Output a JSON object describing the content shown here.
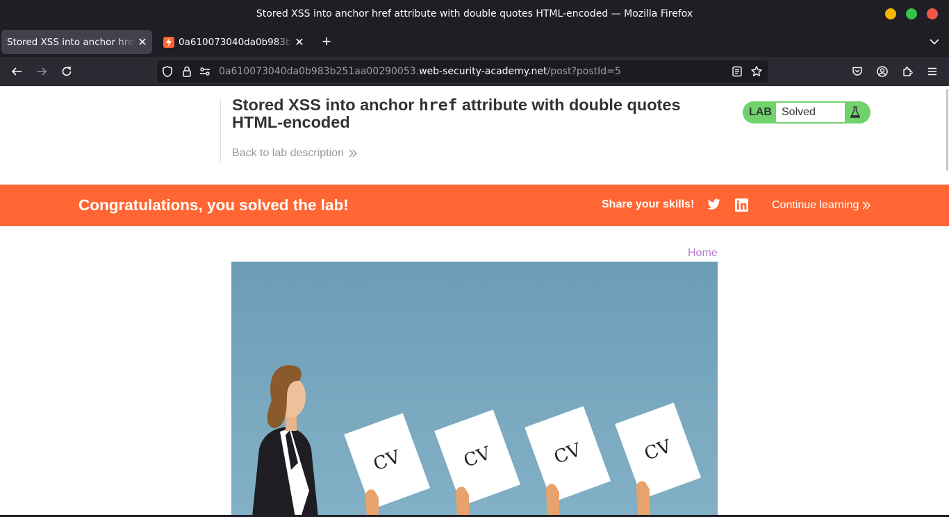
{
  "window": {
    "title": "Stored XSS into anchor href attribute with double quotes HTML-encoded — Mozilla Firefox",
    "controls": {
      "minimize_color": "#f5b500",
      "maximize_color": "#36c24b",
      "close_color": "#f2564b"
    }
  },
  "tabs": [
    {
      "label": "Stored XSS into anchor href attribute with double quotes HTML-encoded",
      "active": true
    },
    {
      "label": "0a610073040da0b983b251aa00290053.web-security-academy.net",
      "active": false,
      "favicon": "lightning-icon"
    }
  ],
  "address": {
    "prefix": "0a610073040da0b983b251aa00290053.",
    "host": "web-security-academy.net",
    "path": "/post?postId=5"
  },
  "lab": {
    "title_before": "Stored XSS into anchor ",
    "title_code": "href",
    "title_after": " attribute with double quotes HTML-encoded",
    "back_link": "Back to lab description",
    "badge_label": "LAB",
    "status": "Solved",
    "badge_color": "#70d16d"
  },
  "banner": {
    "message": "Congratulations, you solved the lab!",
    "share_label": "Share your skills!",
    "continue_label": "Continue learning",
    "color": "#ff6633"
  },
  "blog": {
    "home_link": "Home",
    "image_text": [
      "CV",
      "CV",
      "CV",
      "CV"
    ],
    "link_color": "#b57ccf"
  }
}
